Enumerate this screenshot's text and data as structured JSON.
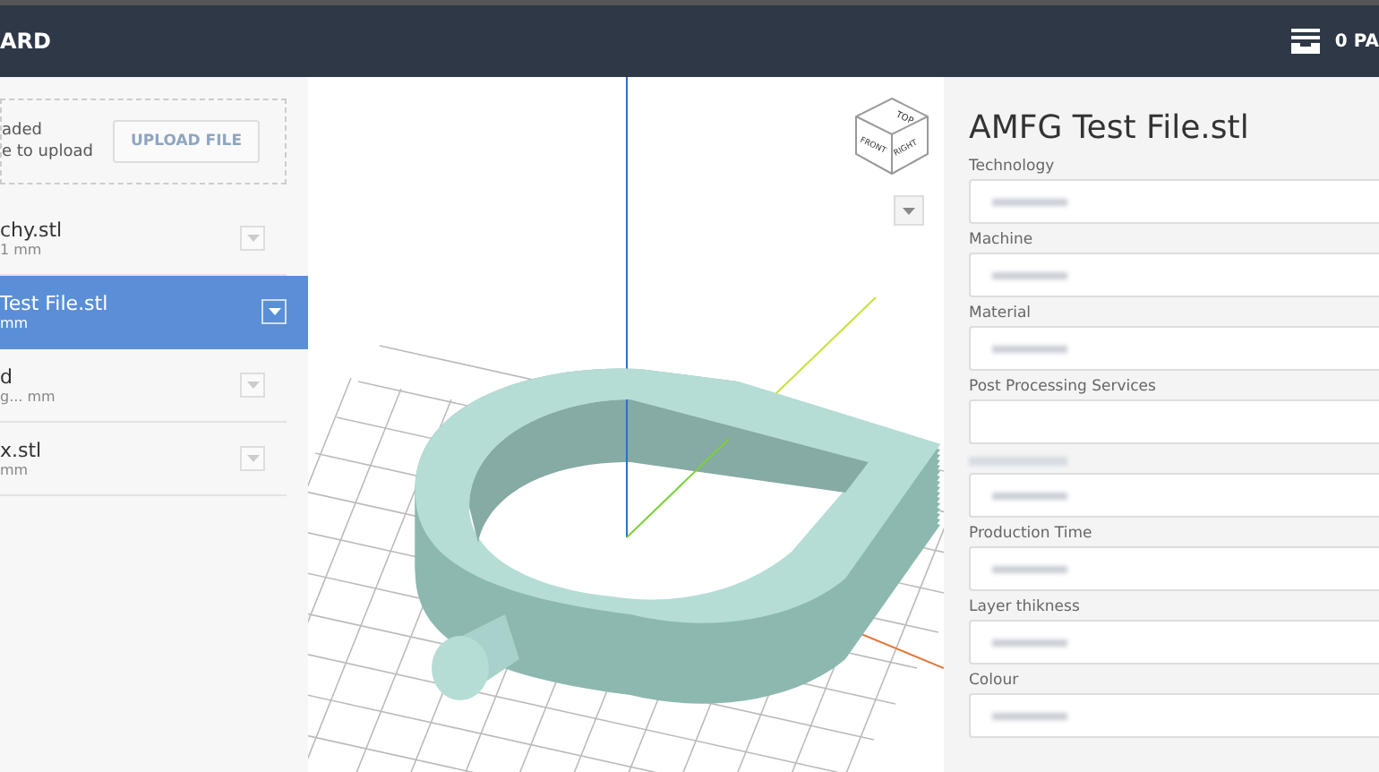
{
  "header": {
    "title": "ARD",
    "cart": "0 PA"
  },
  "upload": {
    "lines": [
      "aded",
      "e to upload"
    ],
    "button": "UPLOAD FILE"
  },
  "files": [
    {
      "name": "chy.stl",
      "meta": "1  mm",
      "selected": false
    },
    {
      "name": "Test File.stl",
      "meta": "mm",
      "selected": true
    },
    {
      "name": "d",
      "meta": "g...  mm",
      "selected": false
    },
    {
      "name": "x.stl",
      "meta": "mm",
      "selected": false
    }
  ],
  "viewer": {
    "cube_faces": [
      "TOP",
      "FRONT",
      "RIGHT"
    ]
  },
  "details": {
    "title": "AMFG Test File.stl",
    "fields": [
      {
        "label": "Technology",
        "blurred": true
      },
      {
        "label": "Machine",
        "blurred": true
      },
      {
        "label": "Material",
        "blurred": true
      },
      {
        "label": "Post Processing Services",
        "blurred": false
      },
      {
        "label_blurred": true,
        "blurred": true
      },
      {
        "label": "Production Time",
        "blurred": true
      },
      {
        "label": "Layer thikness",
        "blurred": true
      },
      {
        "label": "Colour",
        "blurred": true
      }
    ]
  }
}
